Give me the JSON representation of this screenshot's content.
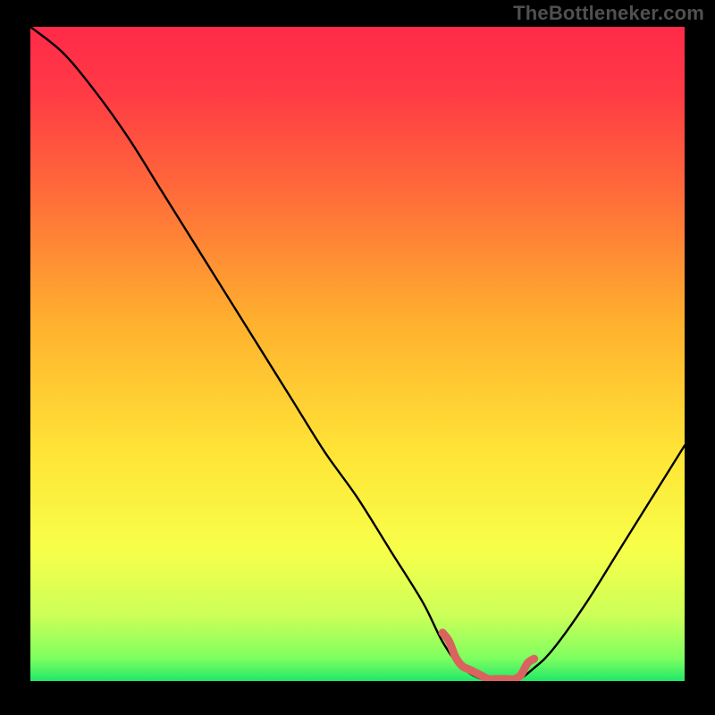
{
  "watermark": "TheBottleneker.com",
  "colors": {
    "bg": "#000000",
    "curve": "#000000",
    "marker": "#d9645f",
    "gradient_stops": [
      {
        "offset": 0.0,
        "color": "#ff2a49"
      },
      {
        "offset": 0.1,
        "color": "#ff3a45"
      },
      {
        "offset": 0.25,
        "color": "#ff6a3a"
      },
      {
        "offset": 0.45,
        "color": "#ffb02e"
      },
      {
        "offset": 0.65,
        "color": "#ffe436"
      },
      {
        "offset": 0.8,
        "color": "#f7ff4a"
      },
      {
        "offset": 0.9,
        "color": "#ccff58"
      },
      {
        "offset": 0.965,
        "color": "#7fff60"
      },
      {
        "offset": 1.0,
        "color": "#20e868"
      }
    ]
  },
  "chart_data": {
    "type": "line",
    "title": "",
    "xlabel": "",
    "ylabel": "",
    "xlim": [
      0,
      100
    ],
    "ylim": [
      0,
      100
    ],
    "series": [
      {
        "name": "bottleneck-curve",
        "x": [
          0,
          5,
          10,
          15,
          20,
          25,
          30,
          35,
          40,
          45,
          50,
          55,
          60,
          63,
          66,
          70,
          74,
          77,
          80,
          85,
          90,
          95,
          100
        ],
        "values": [
          100,
          96,
          90,
          83,
          75,
          67,
          59,
          51,
          43,
          35,
          28,
          20,
          12,
          6,
          2,
          0,
          0,
          2,
          5,
          12,
          20,
          28,
          36
        ]
      }
    ],
    "optimal_range_x": [
      63,
      77
    ],
    "annotations": []
  }
}
